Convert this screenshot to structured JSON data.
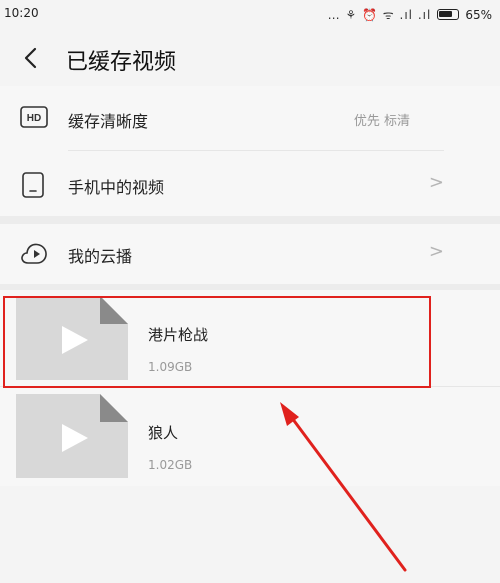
{
  "status_bar": {
    "time": "10:20",
    "icons": "… ⚘ ⏰ ᯤ .ıl .ıl",
    "battery": "65%"
  },
  "header": {
    "title": "已缓存视频",
    "back_icon": "back-chevron-icon"
  },
  "settings": {
    "quality": {
      "icon": "hd-icon",
      "label": "缓存清晰度",
      "value": "优先 标清"
    },
    "phone_videos": {
      "icon": "phone-icon",
      "label": "手机中的视频",
      "chevron": ">"
    },
    "cloud": {
      "icon": "cloud-play-icon",
      "label": "我的云播",
      "chevron": ">"
    }
  },
  "videos": [
    {
      "title": "港片枪战",
      "size": "1.09GB",
      "thumbnail_icon": "play-icon"
    },
    {
      "title": "狼人",
      "size": "1.02GB",
      "thumbnail_icon": "play-icon"
    }
  ],
  "colors": {
    "accent": "#e0211d",
    "thumbnail": "#d8d8d8",
    "text_secondary": "#999999"
  }
}
